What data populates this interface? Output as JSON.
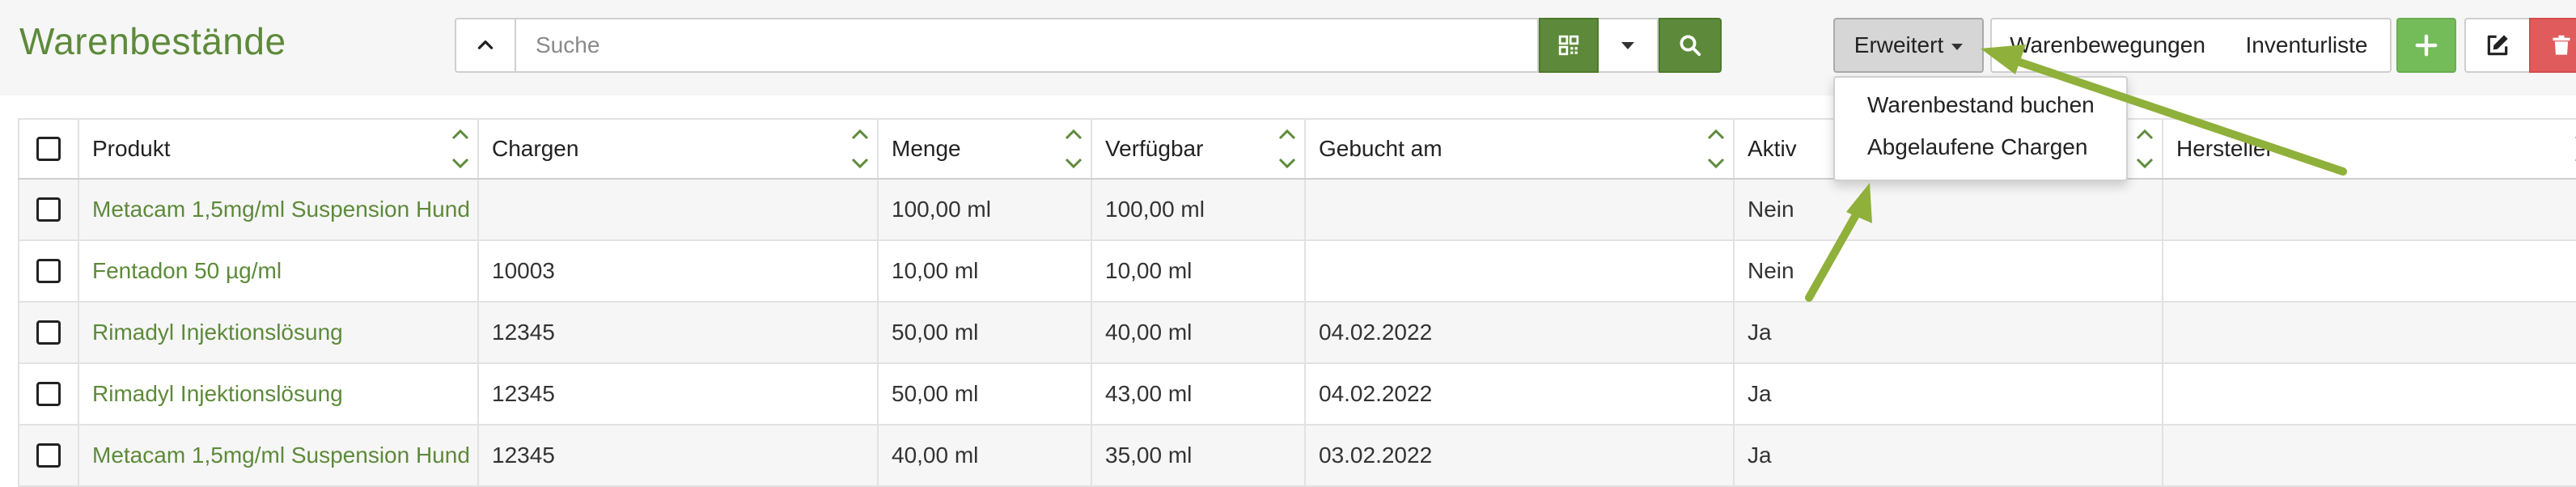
{
  "page": {
    "title": "Warenbestände"
  },
  "search": {
    "placeholder": "Suche",
    "icons": {
      "collapse": "chevron-up-icon",
      "qr": "qr-code-icon",
      "dropdown": "caret-down-icon",
      "search": "search-icon"
    }
  },
  "toolbar": {
    "erweitert_label": "Erweitert",
    "warenbewegungen_label": "Warenbewegungen",
    "inventurliste_label": "Inventurliste",
    "icons": {
      "add": "plus-icon",
      "edit": "edit-icon",
      "delete": "trash-icon"
    }
  },
  "dropdown": {
    "items": [
      {
        "label": "Warenbestand buchen"
      },
      {
        "label": "Abgelaufene Chargen"
      }
    ]
  },
  "table": {
    "columns": [
      "Produkt",
      "Chargen",
      "Menge",
      "Verfügbar",
      "Gebucht am",
      "Aktiv",
      "Hersteller"
    ],
    "rows": [
      {
        "produkt": "Metacam 1,5mg/ml Suspension Hund",
        "chargen": "",
        "menge": "100,00 ml",
        "verfuegbar": "100,00 ml",
        "gebucht": "",
        "aktiv": "Nein",
        "hersteller": ""
      },
      {
        "produkt": "Fentadon 50 µg/ml",
        "chargen": "10003",
        "menge": "10,00 ml",
        "verfuegbar": "10,00 ml",
        "gebucht": "",
        "aktiv": "Nein",
        "hersteller": ""
      },
      {
        "produkt": "Rimadyl Injektionslösung",
        "chargen": "12345",
        "menge": "50,00 ml",
        "verfuegbar": "40,00 ml",
        "gebucht": "04.02.2022",
        "aktiv": "Ja",
        "hersteller": ""
      },
      {
        "produkt": "Rimadyl Injektionslösung",
        "chargen": "12345",
        "menge": "50,00 ml",
        "verfuegbar": "43,00 ml",
        "gebucht": "04.02.2022",
        "aktiv": "Ja",
        "hersteller": ""
      },
      {
        "produkt": "Metacam 1,5mg/ml Suspension Hund",
        "chargen": "12345",
        "menge": "40,00 ml",
        "verfuegbar": "35,00 ml",
        "gebucht": "03.02.2022",
        "aktiv": "Ja",
        "hersteller": ""
      }
    ]
  },
  "colors": {
    "brand": "#5d8a3a",
    "add": "#74bb5a",
    "delete": "#e05b5b",
    "annotation_arrow": "#8fb03a"
  }
}
